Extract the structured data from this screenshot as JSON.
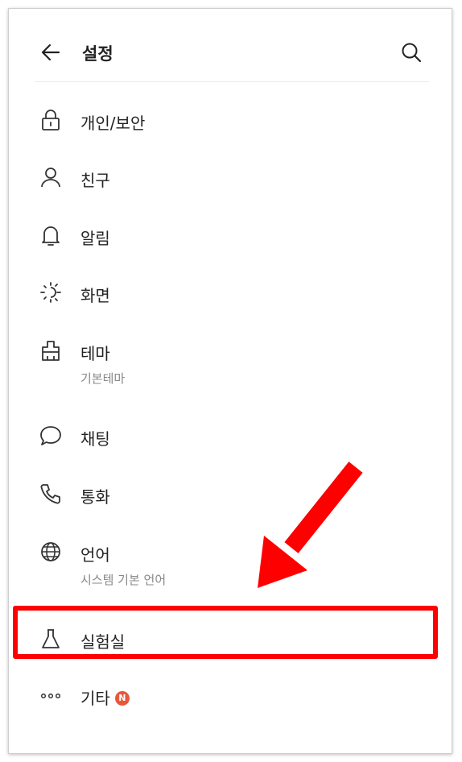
{
  "header": {
    "title": "설정",
    "back_icon": "arrow-left-icon",
    "search_icon": "search-icon"
  },
  "menu": [
    {
      "label": "개인/보안",
      "icon": "lock-icon"
    },
    {
      "label": "친구",
      "icon": "person-icon"
    },
    {
      "label": "알림",
      "icon": "bell-icon"
    },
    {
      "label": "화면",
      "icon": "sun-icon"
    },
    {
      "label": "테마",
      "sub": "기본테마",
      "icon": "brush-icon"
    },
    {
      "label": "채팅",
      "icon": "chat-bubble-icon"
    },
    {
      "label": "통화",
      "icon": "phone-icon"
    },
    {
      "label": "언어",
      "sub": "시스템 기본 언어",
      "icon": "globe-icon"
    },
    {
      "label": "실험실",
      "icon": "flask-icon"
    },
    {
      "label": "기타",
      "icon": "more-dots-icon",
      "badge": "N"
    }
  ],
  "annotation": {
    "highlight_color": "#ff0000",
    "arrow_color": "#ff0000"
  },
  "colors": {
    "badge": "#e8583a",
    "text": "#222222",
    "subtext": "#888888"
  }
}
